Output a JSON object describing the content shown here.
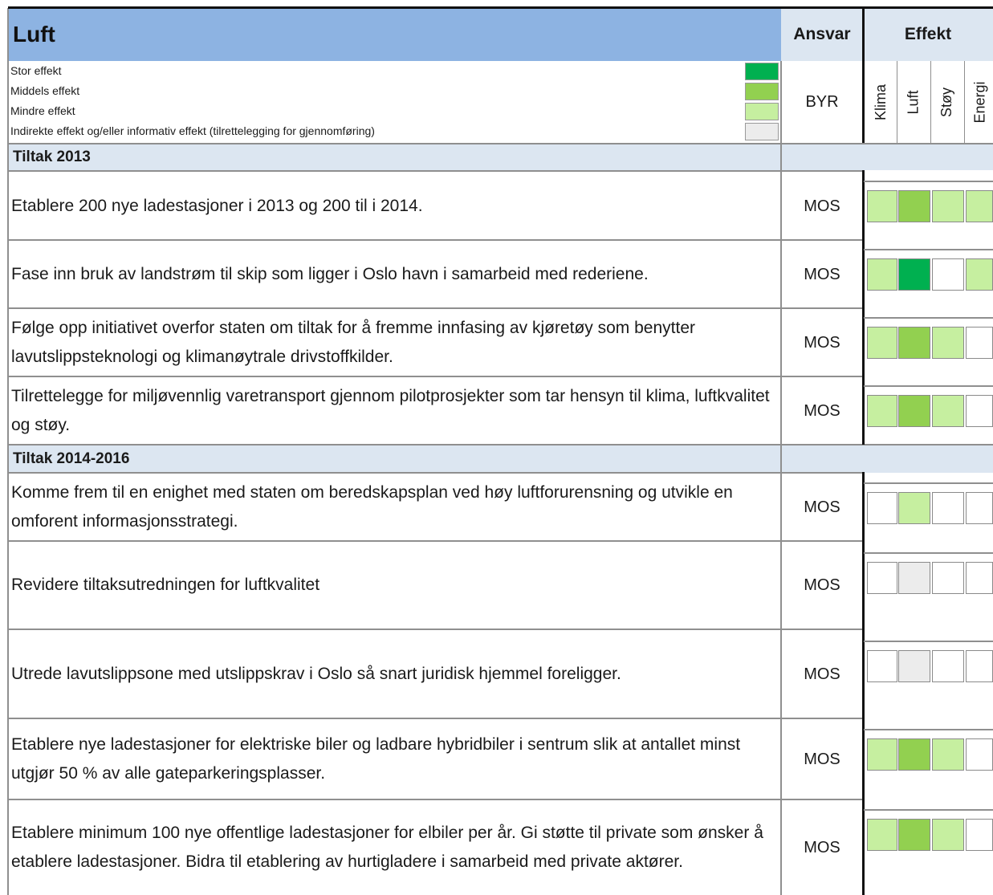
{
  "header": {
    "title": "Luft",
    "ansvar_label": "Ansvar",
    "effekt_label": "Effekt",
    "ansvar_value": "BYR",
    "effect_columns": [
      "Klima",
      "Luft",
      "Støy",
      "Energi"
    ]
  },
  "legend": [
    {
      "label": "Stor effekt",
      "color": "#00b050"
    },
    {
      "label": "Middels effekt",
      "color": "#92d050"
    },
    {
      "label": "Mindre effekt",
      "color": "#c6efa0"
    },
    {
      "label": "Indirekte effekt og/eller informativ effekt (tilrettelegging for gjennomføring)",
      "color": "#ececec"
    }
  ],
  "colors": {
    "header_blue": "#8db3e2",
    "section_band": "#dce6f1",
    "stor": "#00b050",
    "middels": "#92d050",
    "mindre": "#c6efa0",
    "indirekte": "#ececec",
    "none": "#ffffff"
  },
  "sections": [
    {
      "title": "Tiltak 2013",
      "rows": [
        {
          "text": "Etablere 200 nye ladestasjoner i 2013 og 200 til i 2014.",
          "ansvar": "MOS",
          "effects": [
            "mindre",
            "middels",
            "mindre",
            "mindre"
          ]
        },
        {
          "text": "Fase inn bruk av landstrøm til skip som ligger i Oslo havn i samarbeid med rederiene.",
          "ansvar": "MOS",
          "effects": [
            "mindre",
            "stor",
            "none",
            "mindre"
          ]
        },
        {
          "text": "Følge opp initiativet overfor staten om tiltak for å fremme innfasing av kjøretøy som benytter lavutslippsteknologi og klimanøytrale drivstoffkilder.",
          "ansvar": "MOS",
          "effects": [
            "mindre",
            "middels",
            "mindre",
            "none"
          ]
        },
        {
          "text": "Tilrettelegge for miljøvennlig varetransport gjennom pilotprosjekter som tar hensyn til klima, luftkvalitet og støy.",
          "ansvar": "MOS",
          "effects": [
            "mindre",
            "middels",
            "mindre",
            "none"
          ]
        }
      ]
    },
    {
      "title": "Tiltak 2014-2016",
      "rows": [
        {
          "text": "Komme frem til en enighet med staten om beredskapsplan ved høy luftforurensning og utvikle en omforent informasjonsstrategi.",
          "ansvar": "MOS",
          "effects": [
            "none",
            "mindre",
            "none",
            "none"
          ]
        },
        {
          "text": "Revidere tiltaksutredningen for luftkvalitet",
          "ansvar": "MOS",
          "effects": [
            "none",
            "indirekte",
            "none",
            "none"
          ]
        },
        {
          "text": "Utrede lavutslippsone med utslippskrav i Oslo så snart juridisk hjemmel foreligger.",
          "ansvar": "MOS",
          "effects": [
            "none",
            "indirekte",
            "none",
            "none"
          ]
        },
        {
          "text": "Etablere nye ladestasjoner for elektriske biler og ladbare hybridbiler i sentrum slik at antallet minst utgjør  50 % av alle gateparkeringsplasser.",
          "ansvar": "MOS",
          "effects": [
            "mindre",
            "middels",
            "mindre",
            "none"
          ]
        },
        {
          "text": "Etablere minimum 100 nye offentlige ladestasjoner for elbiler per år.  Gi støtte til private som ønsker å etablere ladestasjoner. Bidra til etablering av hurtigladere i samarbeid med private aktører.",
          "ansvar": "MOS",
          "effects": [
            "mindre",
            "middels",
            "mindre",
            "none"
          ]
        }
      ]
    }
  ]
}
